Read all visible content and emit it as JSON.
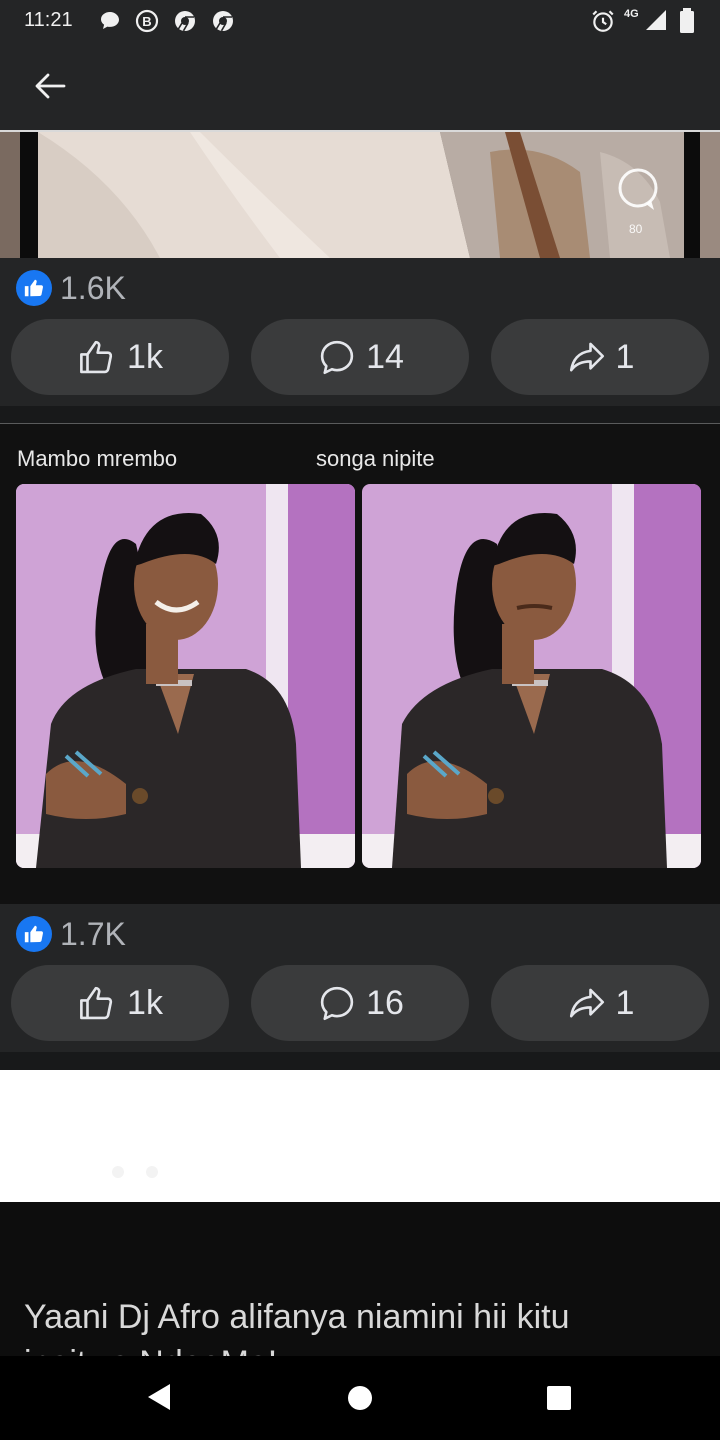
{
  "status_bar": {
    "time": "11:21",
    "network": "4G",
    "notification_icons": [
      "chat-bubble-icon",
      "b-circle-icon",
      "chrome-icon",
      "chrome-icon"
    ],
    "right_icons": [
      "alarm-icon",
      "signal-icon",
      "battery-icon"
    ]
  },
  "top_bar": {
    "back_icon": "arrow-left-icon"
  },
  "post1": {
    "embedded_comment_count": "80",
    "reaction_count": "1.6K",
    "like_label": "1k",
    "comment_label": "14",
    "share_label": "1"
  },
  "post2": {
    "caption_left": "Mambo mrembo",
    "caption_right": "songa nipite",
    "reaction_count": "1.7K",
    "like_label": "1k",
    "comment_label": "16",
    "share_label": "1"
  },
  "post3": {
    "text_line1": "Yaani Dj Afro alifanya niamini hii kitu",
    "text_line2": "inaitwa NdeeMa!"
  },
  "nav": {
    "items": [
      "back-triangle-icon",
      "home-circle-icon",
      "recents-square-icon"
    ]
  },
  "colors": {
    "accent": "#1877f2",
    "background": "#242526",
    "button": "#3a3b3c"
  }
}
